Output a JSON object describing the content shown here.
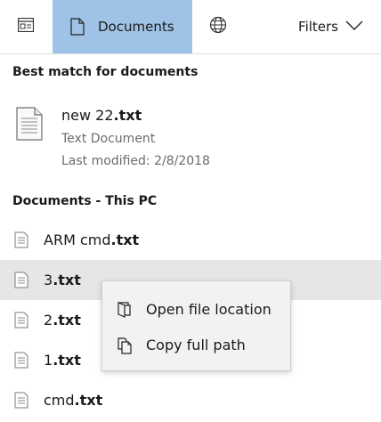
{
  "tabs": {
    "apps_icon": "window-icon",
    "documents": {
      "label": "Documents",
      "icon": "document-icon"
    },
    "web_icon": "globe-icon",
    "filters": {
      "label": "Filters",
      "icon": "chevron-down-icon"
    }
  },
  "best_match": {
    "heading": "Best match for documents",
    "item": {
      "name_base": "new 22",
      "name_ext": ".txt",
      "type": "Text Document",
      "modified": "Last modified: 2/8/2018",
      "icon": "text-document-icon"
    }
  },
  "documents_pc": {
    "heading": "Documents - This PC",
    "items": [
      {
        "base": "ARM cmd",
        "ext": ".txt"
      },
      {
        "base": "3",
        "ext": ".txt",
        "selected": true
      },
      {
        "base": "2",
        "ext": ".txt"
      },
      {
        "base": "1",
        "ext": ".txt"
      },
      {
        "base": "cmd",
        "ext": ".txt"
      }
    ]
  },
  "context_menu": {
    "items": [
      {
        "label": "Open file location",
        "icon": "folder-location-icon"
      },
      {
        "label": "Copy full path",
        "icon": "copy-icon"
      }
    ]
  },
  "colors": {
    "active_tab": "#9ec3e6",
    "selected_row": "#e6e6e6",
    "menu_bg": "#f2f2f2",
    "secondary_text": "#6b6b6b"
  }
}
